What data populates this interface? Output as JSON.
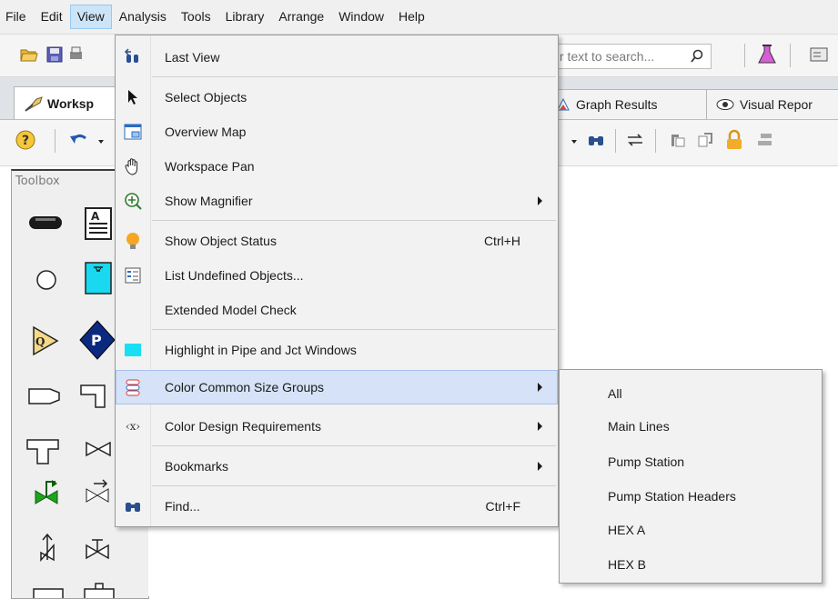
{
  "menubar": [
    "File",
    "Edit",
    "View",
    "Analysis",
    "Tools",
    "Library",
    "Arrange",
    "Window",
    "Help"
  ],
  "search": {
    "placeholder": "r text to search..."
  },
  "tabs": {
    "workspace": "Worksp",
    "graph_results": "Graph Results",
    "visual_report": "Visual Repor"
  },
  "toolbox": {
    "title": "Toolbox"
  },
  "view_menu": {
    "last_view": "Last View",
    "select_objects": "Select Objects",
    "overview_map": "Overview Map",
    "workspace_pan": "Workspace Pan",
    "show_magnifier": "Show Magnifier",
    "show_object_status": "Show Object Status",
    "show_object_status_shortcut": "Ctrl+H",
    "list_undefined": "List Undefined Objects...",
    "extended_model_check": "Extended Model Check",
    "highlight": "Highlight in Pipe and Jct Windows",
    "color_common": "Color Common Size Groups",
    "color_design_icon": "‹x›",
    "color_design": "Color Design Requirements",
    "bookmarks": "Bookmarks",
    "find": "Find...",
    "find_shortcut": "Ctrl+F"
  },
  "size_groups": [
    "All",
    "Main Lines",
    "Pump Station",
    "Pump Station Headers",
    "HEX A",
    "HEX B"
  ],
  "colors": {
    "menu_hover": "#d5e2f7",
    "menu_active": "#cce4f7",
    "highlight_swatch": "#19dff5"
  }
}
